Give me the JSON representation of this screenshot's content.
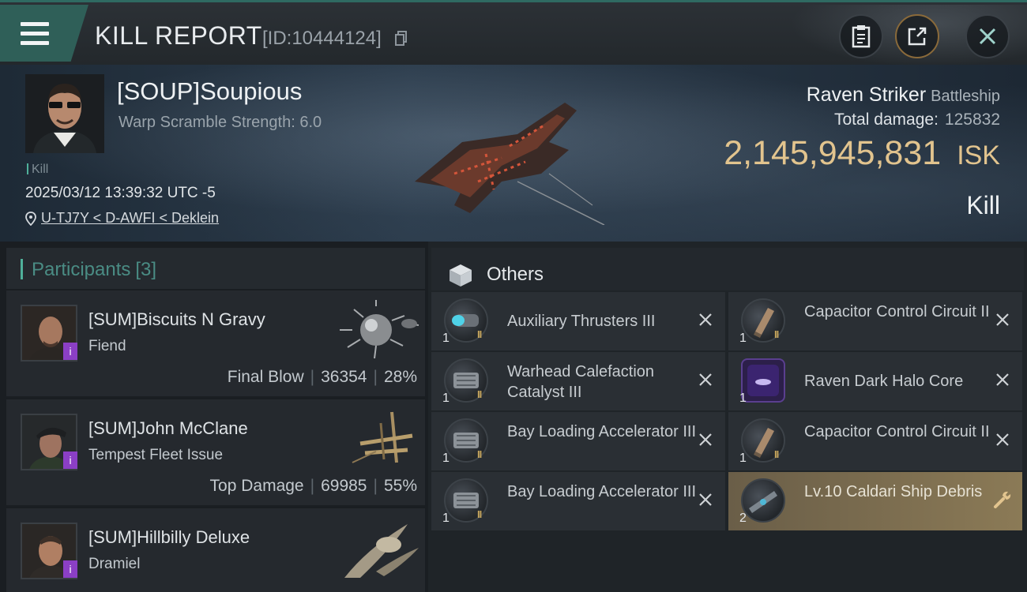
{
  "header": {
    "title": "KILL REPORT",
    "report_id": "[ID:10444124]"
  },
  "victim": {
    "name": "[SOUP]Soupious",
    "warp_scramble": "Warp Scramble Strength: 6.0",
    "kill_tag": "Kill",
    "datetime": "2025/03/12 13:39:32 UTC -5",
    "location": "U-TJ7Y < D-AWFI < Deklein"
  },
  "ship": {
    "name": "Raven Striker",
    "class": "Battleship",
    "damage_label": "Total damage:",
    "damage_value": "125832",
    "isk_value": "2,145,945,831",
    "isk_unit": "ISK",
    "result": "Kill"
  },
  "participants": {
    "label": "Participants",
    "count": "[3]",
    "items": [
      {
        "name": "[SUM]Biscuits N Gravy",
        "ship": "Fiend",
        "role": "Final Blow",
        "damage": "36354",
        "percent": "28%"
      },
      {
        "name": "[SUM]John McClane",
        "ship": "Tempest Fleet Issue",
        "role": "Top Damage",
        "damage": "69985",
        "percent": "55%"
      },
      {
        "name": "[SUM]Hillbilly Deluxe",
        "ship": "Dramiel"
      }
    ]
  },
  "others": {
    "label": "Others",
    "items": [
      {
        "name": "Auxiliary Thrusters III",
        "qty": "1",
        "meta": "II"
      },
      {
        "name": "Capacitor Control Circuit II",
        "qty": "1",
        "meta": "II"
      },
      {
        "name": "Warhead Calefaction Catalyst III",
        "qty": "1",
        "meta": "II"
      },
      {
        "name": "Raven Dark Halo Core",
        "qty": "1",
        "meta": ""
      },
      {
        "name": "Bay Loading Accelerator III",
        "qty": "1",
        "meta": "II"
      },
      {
        "name": "Capacitor Control Circuit II",
        "qty": "1",
        "meta": "II"
      },
      {
        "name": "Bay Loading Accelerator III",
        "qty": "1",
        "meta": "II"
      },
      {
        "name": "Lv.10 Caldari Ship Debris",
        "qty": "2",
        "meta": ""
      }
    ]
  },
  "colors": {
    "accent": "#2f5f58",
    "isk": "#e2c48e",
    "highlight": "#8b7a56",
    "badge": "#8b3fc5"
  }
}
